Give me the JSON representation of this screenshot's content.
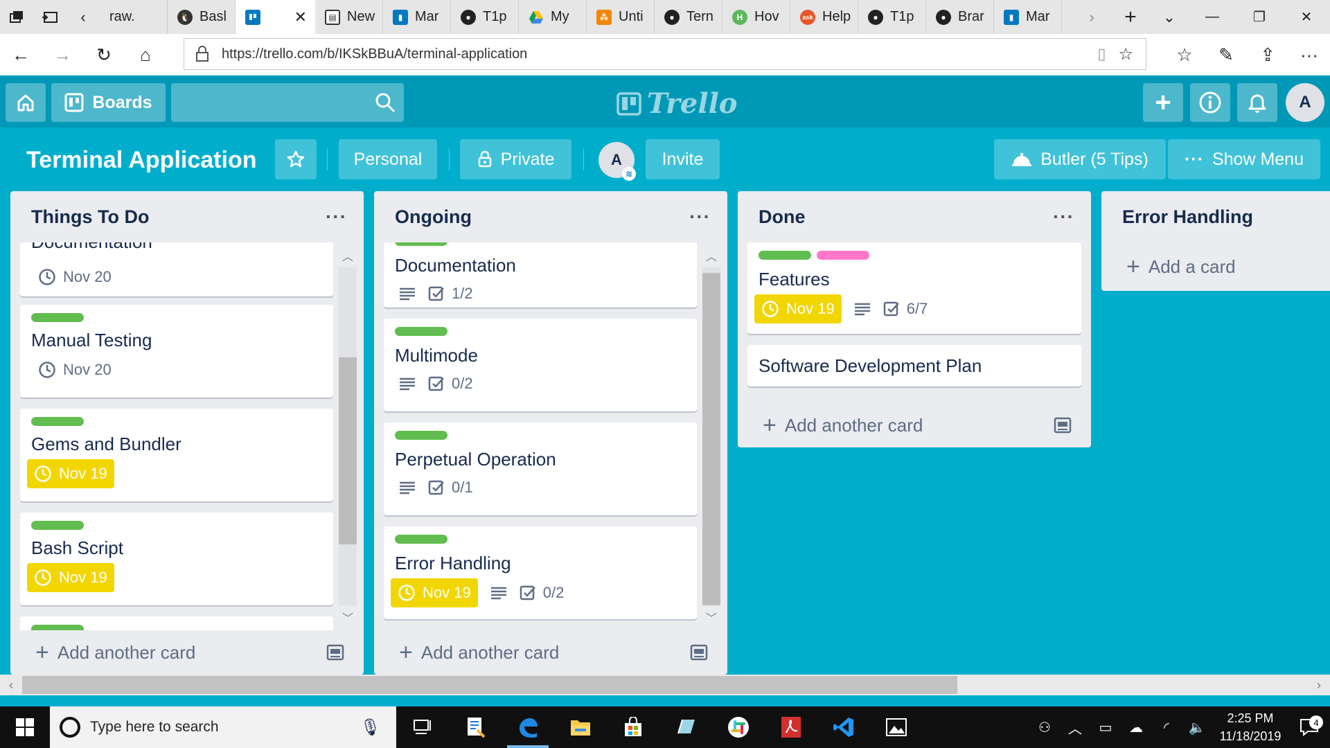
{
  "browser": {
    "tabs": [
      {
        "label": "raw."
      },
      {
        "label": "Basl"
      },
      {
        "label": ""
      },
      {
        "label": "New"
      },
      {
        "label": "Mar"
      },
      {
        "label": "T1p"
      },
      {
        "label": "My"
      },
      {
        "label": "Unti"
      },
      {
        "label": "Tern"
      },
      {
        "label": "Hov"
      },
      {
        "label": "Help"
      },
      {
        "label": "T1p"
      },
      {
        "label": "Brar"
      },
      {
        "label": "Mar"
      }
    ],
    "url": "https://trello.com/b/IKSkBBuA/terminal-application"
  },
  "trello": {
    "boards_label": "Boards",
    "logo_text": "Trello",
    "user_initial": "A"
  },
  "board": {
    "title": "Terminal Application",
    "team_label": "Personal",
    "visibility_label": "Private",
    "member_initial": "A",
    "invite_label": "Invite",
    "butler_label": "Butler (5 Tips)",
    "menu_label": "Show Menu"
  },
  "lists": [
    {
      "title": "Things To Do",
      "footer": "Add another card",
      "cards": [
        {
          "title": "Documentation",
          "due": "Nov 20"
        },
        {
          "title": "Manual Testing",
          "due": "Nov 20"
        },
        {
          "title": "Gems and Bundler",
          "due": "Nov 19"
        },
        {
          "title": "Bash Script",
          "due": "Nov 19"
        }
      ]
    },
    {
      "title": "Ongoing",
      "footer": "Add another card",
      "cards": [
        {
          "title": "Documentation",
          "checklist": "1/2"
        },
        {
          "title": "Multimode",
          "checklist": "0/2"
        },
        {
          "title": "Perpetual Operation",
          "checklist": "0/1"
        },
        {
          "title": "Error Handling",
          "due": "Nov 19",
          "checklist": "0/2"
        }
      ]
    },
    {
      "title": "Done",
      "footer": "Add another card",
      "cards": [
        {
          "title": "Features",
          "due": "Nov 19",
          "checklist": "6/7"
        },
        {
          "title": "Software Development Plan"
        }
      ]
    },
    {
      "title": "Error Handling",
      "footer": "Add a card"
    }
  ],
  "taskbar": {
    "search_placeholder": "Type here to search",
    "time": "2:25 PM",
    "date": "11/18/2019",
    "notification_count": "4"
  },
  "colors": {
    "board_bg": "#00aecc",
    "header_bg": "#0098b7",
    "label_green": "#61bd4f",
    "label_pink": "#ff78cb",
    "due_yellow": "#f2d600"
  }
}
